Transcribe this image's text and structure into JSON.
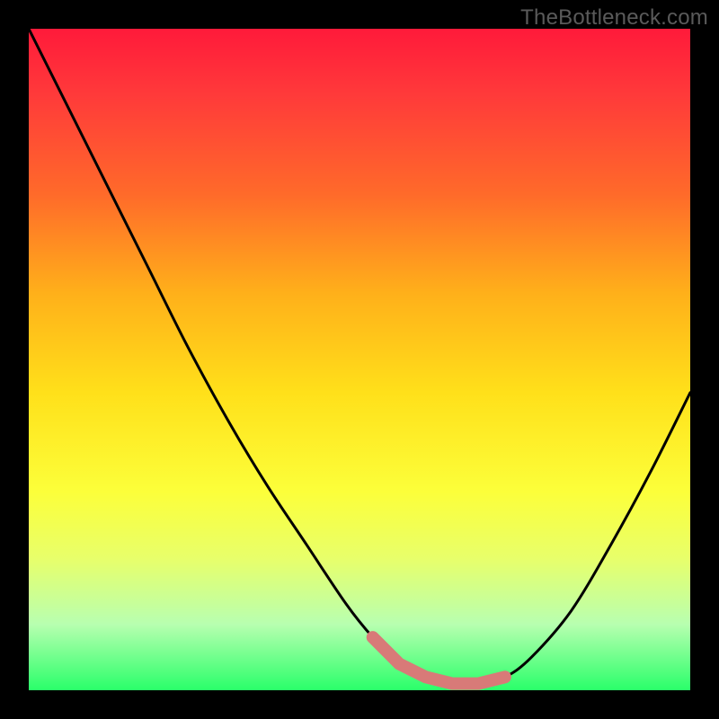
{
  "watermark": "TheBottleneck.com",
  "colors": {
    "page_bg": "#000000",
    "gradient_top": "#ff1a3a",
    "gradient_bottom": "#2aff6a",
    "curve_stroke": "#000000",
    "flat_region_stroke": "#d87a78"
  },
  "chart_data": {
    "type": "line",
    "title": "",
    "xlabel": "",
    "ylabel": "",
    "xlim": [
      0,
      100
    ],
    "ylim": [
      0,
      100
    ],
    "grid": false,
    "legend": false,
    "series": [
      {
        "name": "bottleneck-curve",
        "x": [
          0,
          6,
          12,
          18,
          24,
          30,
          36,
          42,
          48,
          52,
          56,
          60,
          64,
          68,
          72,
          76,
          82,
          88,
          94,
          100
        ],
        "values": [
          100,
          88,
          76,
          64,
          52,
          41,
          31,
          22,
          13,
          8,
          4,
          2,
          1,
          1,
          2,
          5,
          12,
          22,
          33,
          45
        ]
      }
    ],
    "annotations": [
      {
        "name": "optimal-flat-region",
        "x_range": [
          52,
          72
        ],
        "y_approx": 2,
        "color": "#d87a78"
      }
    ]
  }
}
